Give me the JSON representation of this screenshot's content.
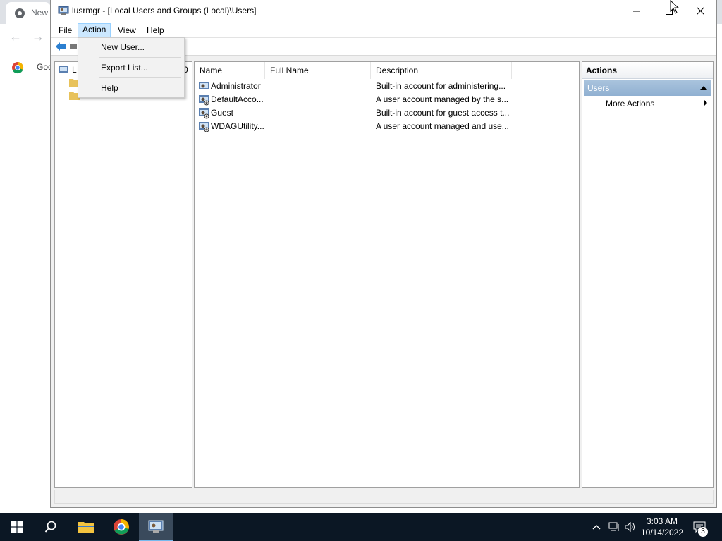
{
  "chrome": {
    "tab_label": "New",
    "bookmark_label": "Goo"
  },
  "window": {
    "title": "lusrmgr - [Local Users and Groups (Local)\\Users]"
  },
  "menubar": {
    "items": [
      "File",
      "Action",
      "View",
      "Help"
    ]
  },
  "action_menu": {
    "items": [
      "New User...",
      "Export List...",
      "Help"
    ]
  },
  "tree": {
    "root_label": "L",
    "root_suffix": "0"
  },
  "list": {
    "columns": [
      "Name",
      "Full Name",
      "Description"
    ],
    "rows": [
      {
        "name": "Administrator",
        "full_name": "",
        "description": "Built-in account for administering..."
      },
      {
        "name": "DefaultAcco...",
        "full_name": "",
        "description": "A user account managed by the s..."
      },
      {
        "name": "Guest",
        "full_name": "",
        "description": "Built-in account for guest access t..."
      },
      {
        "name": "WDAGUtility...",
        "full_name": "",
        "description": "A user account managed and use..."
      }
    ]
  },
  "actions_pane": {
    "header": "Actions",
    "section": "Users",
    "more_actions": "More Actions"
  },
  "taskbar": {
    "time": "3:03 AM",
    "date": "10/14/2022",
    "notification_count": "3"
  },
  "colors": {
    "taskbar_bg": "#0b1724",
    "menu_highlight": "#cce8ff",
    "actions_section_bg": "#9ab7d6"
  }
}
